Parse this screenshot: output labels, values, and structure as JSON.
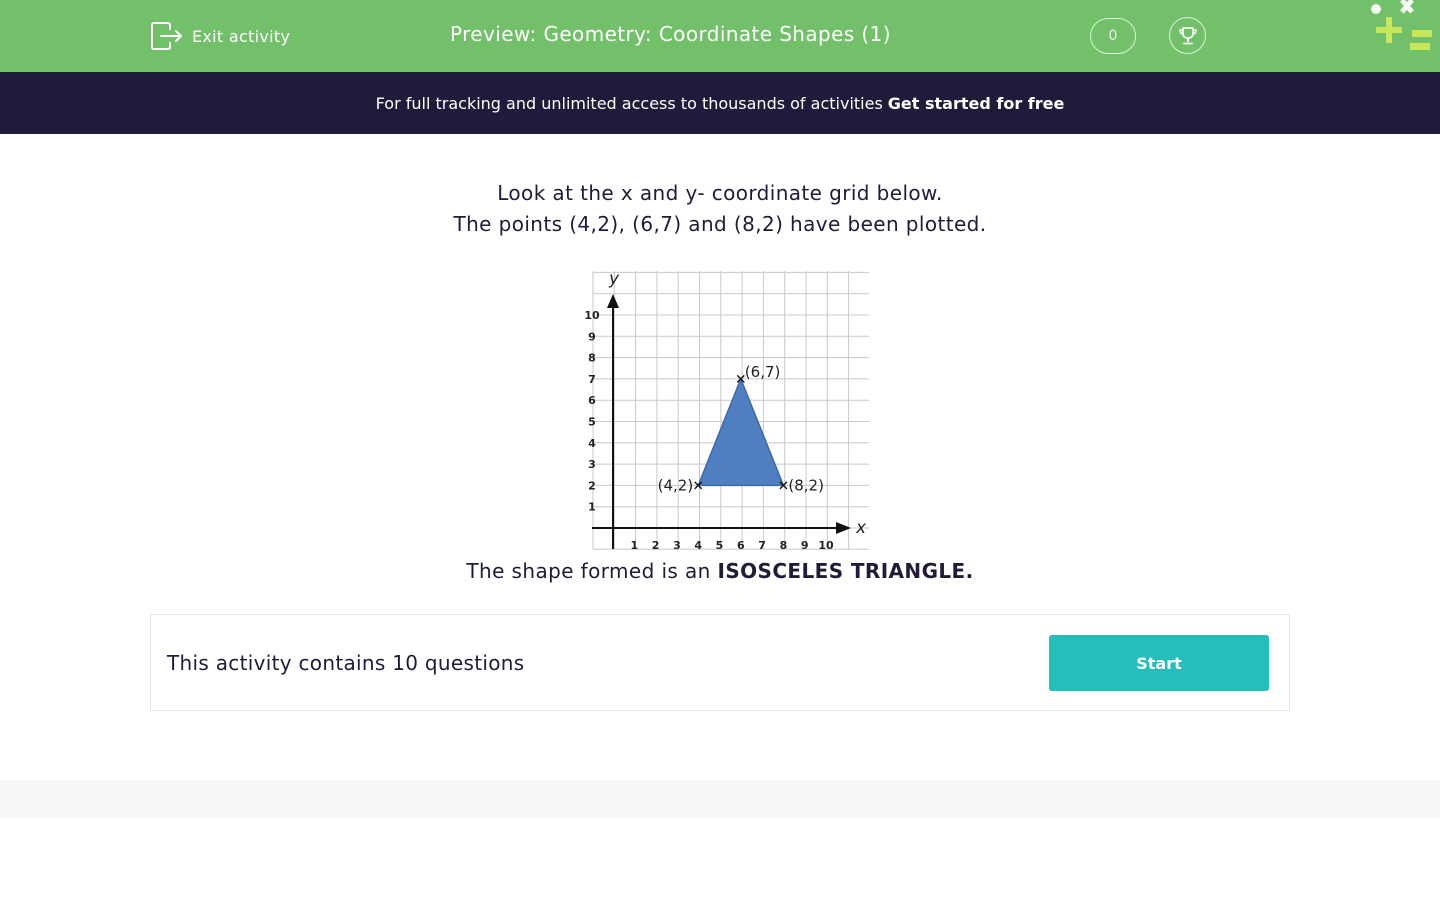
{
  "header": {
    "exit_label": "Exit activity",
    "title": "Preview: Geometry: Coordinate Shapes (1)",
    "score": "0",
    "exit_icon": "exit-icon",
    "trophy_icon": "trophy-icon",
    "logo": "brand-logo"
  },
  "promo": {
    "text": "For full tracking and unlimited access to thousands of activities",
    "link": "Get started for free"
  },
  "question": {
    "line1": "Look at the x and y- coordinate grid below.",
    "line2": "The points (4,2), (6,7) and (8,2) have been plotted."
  },
  "chart_data": {
    "type": "scatter",
    "xlabel": "x",
    "ylabel": "y",
    "xlim": [
      0,
      10
    ],
    "ylim": [
      0,
      10
    ],
    "x_ticks": [
      "1",
      "2",
      "3",
      "4",
      "5",
      "6",
      "7",
      "8",
      "9",
      "10"
    ],
    "y_ticks": [
      "1",
      "2",
      "3",
      "4",
      "5",
      "6",
      "7",
      "8",
      "9",
      "10"
    ],
    "grid": true,
    "points": [
      {
        "x": 4,
        "y": 2,
        "label": "(4,2)"
      },
      {
        "x": 6,
        "y": 7,
        "label": "(6,7)"
      },
      {
        "x": 8,
        "y": 2,
        "label": "(8,2)"
      }
    ],
    "shape": "triangle",
    "fill_color": "#4f7fc1"
  },
  "answer": {
    "prefix": "The shape formed is an",
    "emphasis": "ISOSCELES TRIANGLE."
  },
  "activity": {
    "text": "This activity contains 10 questions",
    "start_label": "Start"
  },
  "colors": {
    "header_green": "#72c16a",
    "promo_navy": "#221a3a",
    "start_teal": "#24bfbd",
    "logo_lime": "#c8e65a"
  }
}
